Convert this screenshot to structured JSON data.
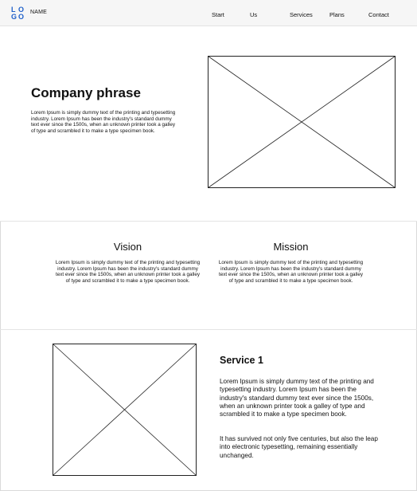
{
  "header": {
    "logo_letters": [
      "L",
      "O",
      "G",
      "O"
    ],
    "brand_name": "NAME",
    "nav": [
      "Start",
      "Us",
      "Services",
      "Plans",
      "Contact"
    ]
  },
  "hero": {
    "title": "Company phrase",
    "text": "Lorem Ipsum is simply dummy text of the printing and typesetting industry. Lorem Ipsum has been the industry's standard dummy text ever since the 1500s, when an unknown printer took a galley of type and scrambled it to make a type specimen book."
  },
  "vision": {
    "title": "Vision",
    "text": "Lorem Ipsum is simply dummy text of the printing and typesetting industry. Lorem Ipsum has been the industry's standard dummy text ever since the 1500s, when an unknown printer took a galley of type and scrambled it to make a type specimen book."
  },
  "mission": {
    "title": "Mission",
    "text": "Lorem Ipsum is simply dummy text of the printing and typesetting industry. Lorem Ipsum has been the industry's standard dummy text ever since the 1500s, when an unknown printer took a galley of type and scrambled it to make a type specimen book."
  },
  "service": {
    "title": "Service 1",
    "paragraph1": "Lorem Ipsum is simply dummy text of the printing and typesetting industry. Lorem Ipsum has been the industry's standard dummy text ever since the 1500s, when an unknown printer took a galley of type and scrambled it to make a type specimen book.",
    "paragraph2": "It has survived not only five centuries, but also the leap into electronic typesetting, remaining essentially unchanged."
  },
  "colors": {
    "logo_blue": "#1e5fc9",
    "header_bg": "#f6f6f6"
  }
}
